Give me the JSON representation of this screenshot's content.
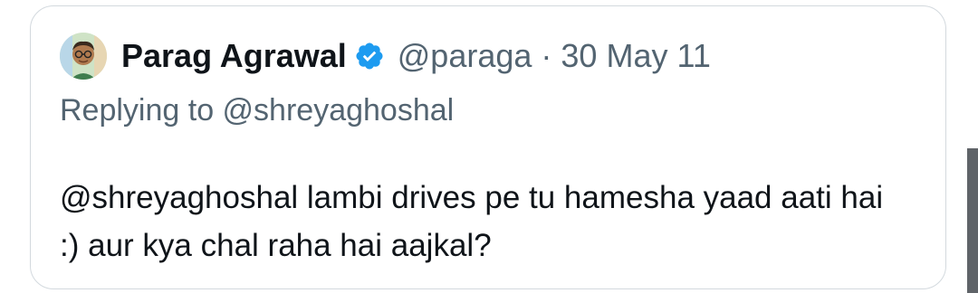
{
  "tweet": {
    "author_name": "Parag Agrawal",
    "author_handle": "@paraga",
    "separator": "·",
    "date": "30 May 11",
    "replying_to": "Replying to @shreyaghoshal",
    "text": "@shreyaghoshal lambi drives pe tu hamesha yaad aati hai :) aur kya chal raha hai aajkal?",
    "avatar_icon": "memoji-avatar",
    "verified_icon": "verified-badge-icon"
  },
  "colors": {
    "text_primary": "#0f1419",
    "text_secondary": "#536471",
    "verified_blue": "#1d9bf0",
    "card_border": "#d3d9de"
  }
}
